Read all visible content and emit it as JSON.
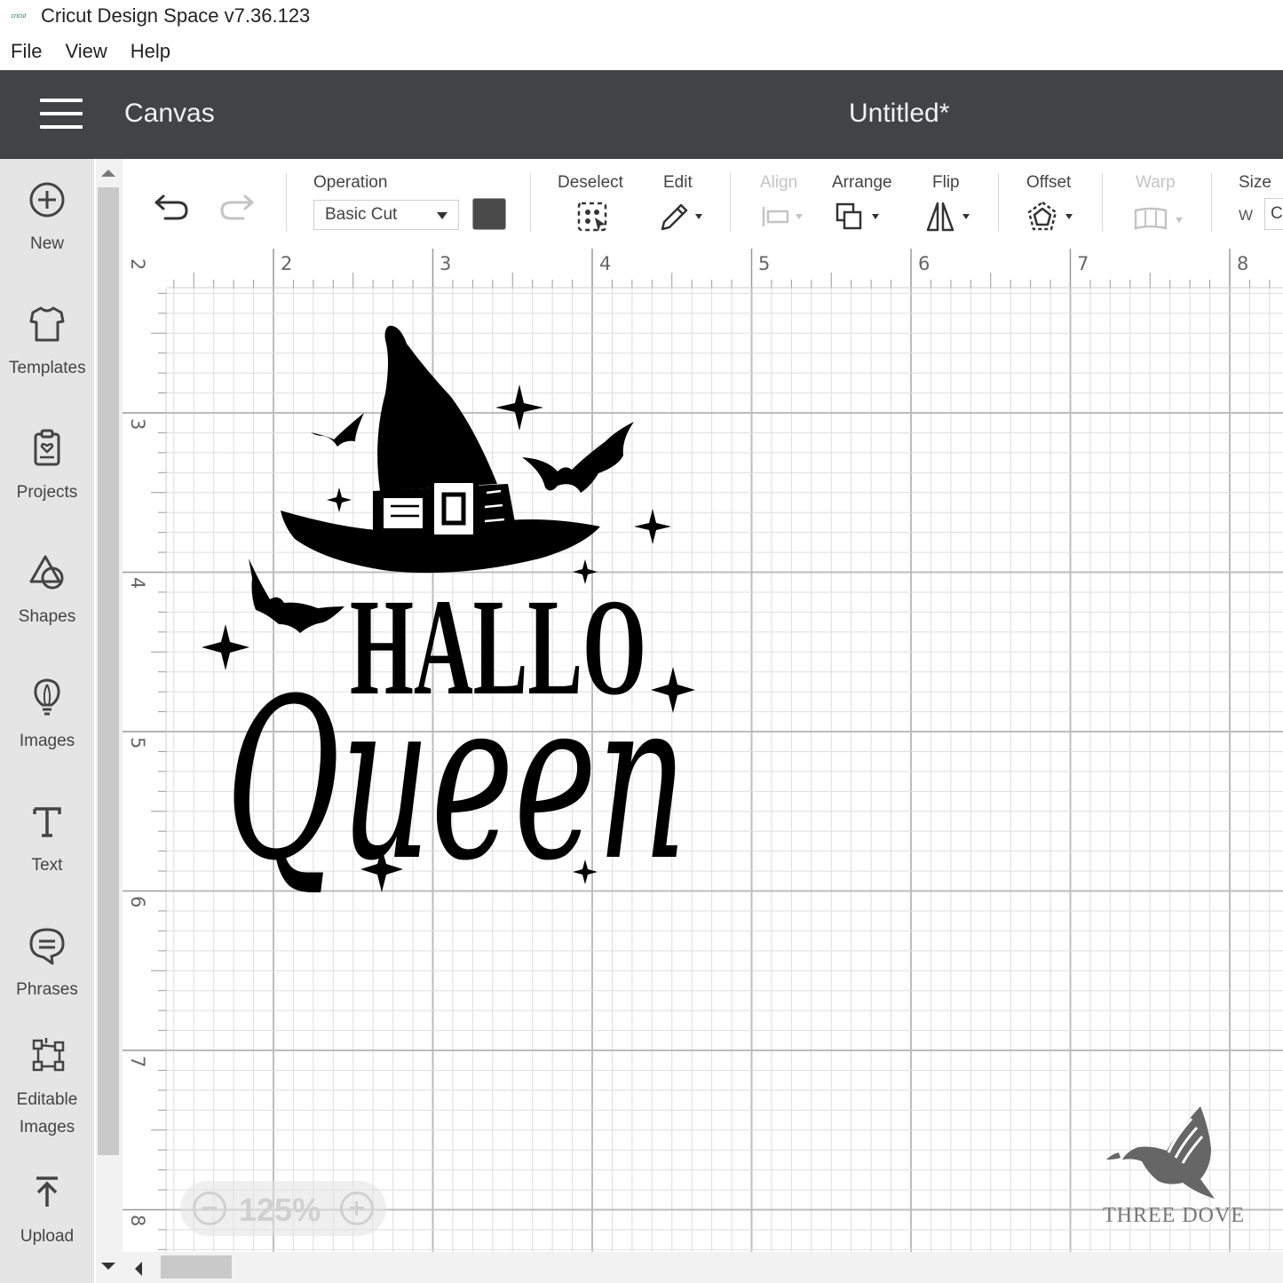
{
  "window": {
    "logo_text": "cricut",
    "title": "Cricut Design Space  v7.36.123"
  },
  "menu": [
    "File",
    "View",
    "Help"
  ],
  "header": {
    "title": "Canvas",
    "document_title": "Untitled*"
  },
  "left_panel": {
    "items": [
      {
        "label": "New",
        "icon": "plus-circle-icon"
      },
      {
        "label": "Templates",
        "icon": "tshirt-icon"
      },
      {
        "label": "Projects",
        "icon": "projects-icon"
      },
      {
        "label": "Shapes",
        "icon": "shapes-icon"
      },
      {
        "label": "Images",
        "icon": "lightbulb-icon"
      },
      {
        "label": "Text",
        "icon": "text-icon"
      },
      {
        "label": "Phrases",
        "icon": "speech-bubble-icon"
      },
      {
        "label": "Editable\nImages",
        "icon": "editable-images-icon"
      },
      {
        "label": "Upload",
        "icon": "upload-icon"
      }
    ]
  },
  "toolbar": {
    "operation_label": "Operation",
    "operation_value": "Basic Cut",
    "operation_color": "#4a4a4a",
    "deselect_label": "Deselect",
    "edit_label": "Edit",
    "align_label": "Align",
    "arrange_label": "Arrange",
    "flip_label": "Flip",
    "offset_label": "Offset",
    "warp_label": "Warp",
    "size_label": "Size",
    "size_w_label": "W",
    "size_w_value": "C"
  },
  "rulers": {
    "top": [
      "2",
      "3",
      "4",
      "5",
      "6",
      "7",
      "8"
    ],
    "left": [
      "2",
      "3",
      "4",
      "5",
      "6",
      "7",
      "8"
    ]
  },
  "zoom": {
    "level": "125%"
  },
  "canvas": {
    "design_line1": "HALLO",
    "design_line2": "Queen"
  },
  "watermark": {
    "text": "THREE DOVE"
  }
}
